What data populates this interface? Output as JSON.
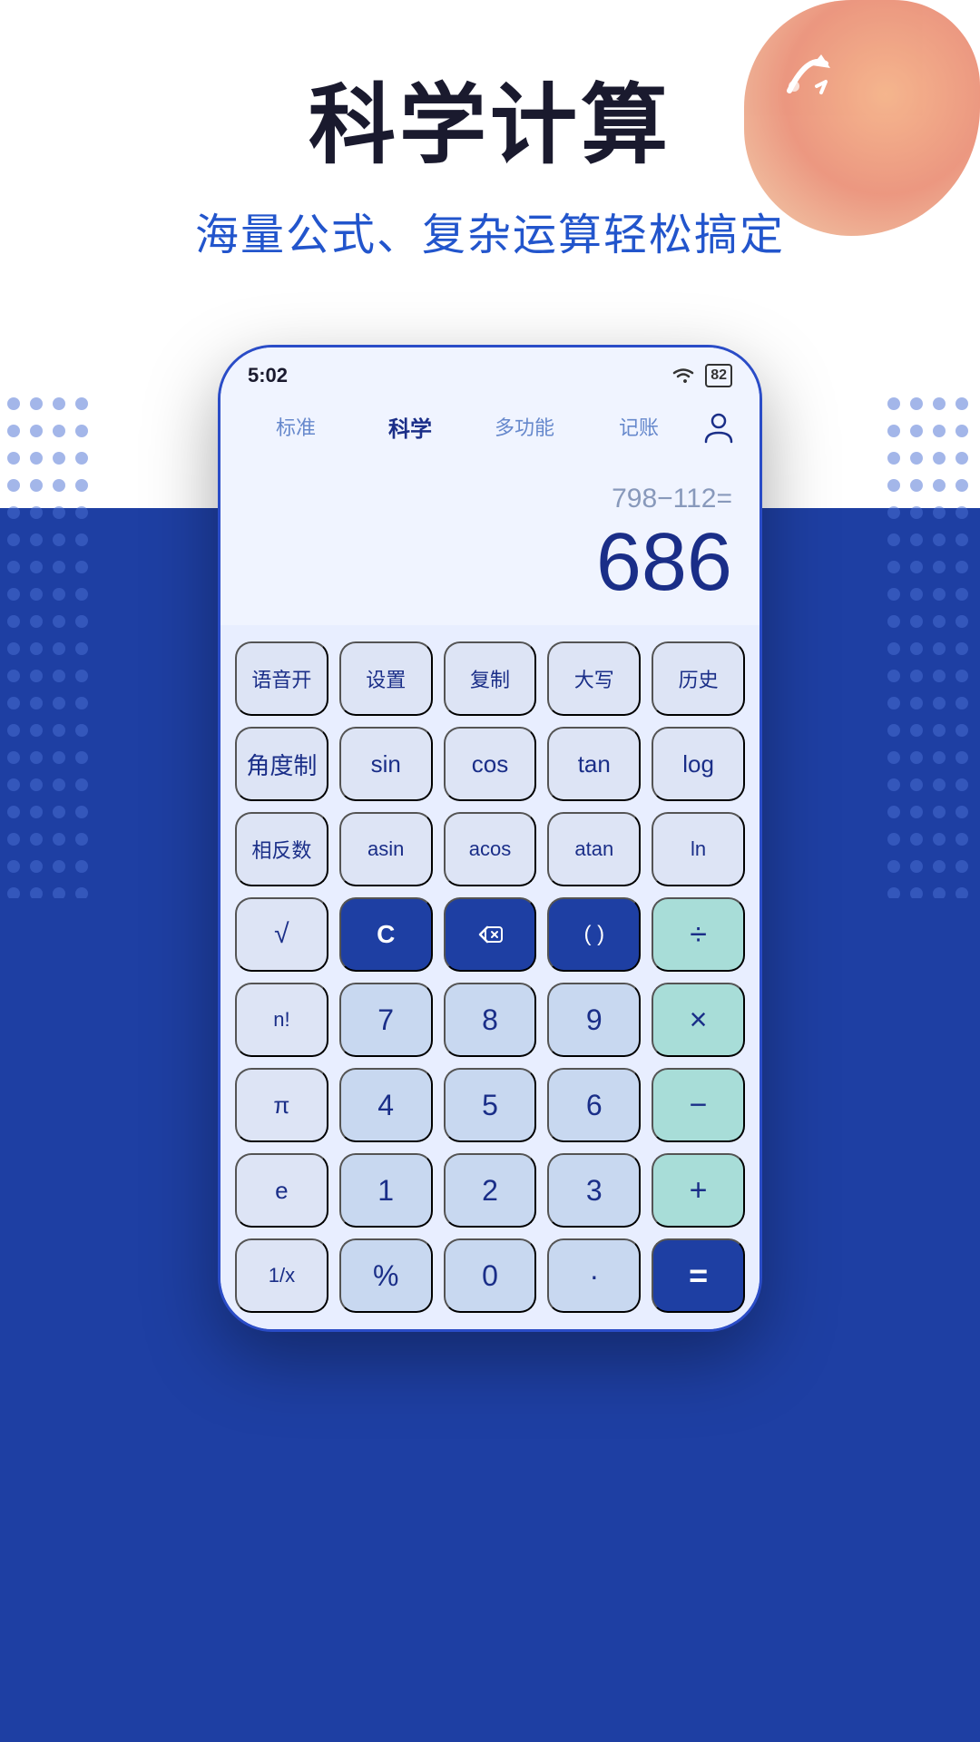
{
  "hero": {
    "title": "科学计算",
    "subtitle": "海量公式、复杂运算轻松搞定"
  },
  "phone": {
    "status": {
      "time": "5:02",
      "battery": "82"
    },
    "tabs": [
      {
        "label": "标准",
        "active": false
      },
      {
        "label": "科学",
        "active": true
      },
      {
        "label": "多功能",
        "active": false
      },
      {
        "label": "记账",
        "active": false
      }
    ],
    "display": {
      "expression": "798−112=",
      "result": "686"
    },
    "keys": {
      "row1": [
        "语音开",
        "设置",
        "复制",
        "大写",
        "历史"
      ],
      "row2": [
        "角度制",
        "sin",
        "cos",
        "tan",
        "log"
      ],
      "row3": [
        "相反数",
        "asin",
        "acos",
        "atan",
        "ln"
      ],
      "row4": [
        "√",
        "C",
        "⌫",
        "( )",
        "÷"
      ],
      "row5": [
        "n!",
        "7",
        "8",
        "9",
        "×"
      ],
      "row6": [
        "π",
        "4",
        "5",
        "6",
        "−"
      ],
      "row7": [
        "e",
        "1",
        "2",
        "3",
        "+"
      ],
      "row8": [
        "1/x",
        "%",
        "0",
        "·",
        "="
      ]
    }
  }
}
